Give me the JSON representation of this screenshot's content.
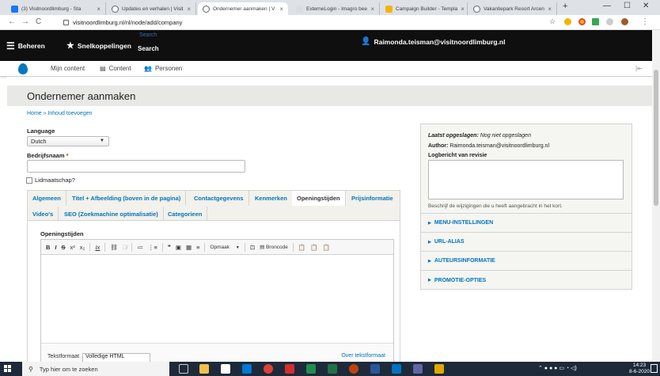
{
  "browser": {
    "tabs": [
      {
        "label": "(3) Visitnoordlimburg - Sta",
        "color": "#1877f2"
      },
      {
        "label": "Updates en verhalen | Visit",
        "color": "#5f6368"
      },
      {
        "label": "Ondernemer aanmaken | V",
        "color": "#5f6368"
      },
      {
        "label": "ExterneLogin - Imagro bee",
        "color": "#dadce0"
      },
      {
        "label": "Campaign Builder - Templa",
        "color": "#f4b400"
      },
      {
        "label": "Vakantiepark Resort Arcen",
        "color": "#5f6368"
      }
    ],
    "tab_close": "×",
    "new_tab": "+",
    "url": "visitnoordlimburg.nl/nl/node/add/company",
    "window_controls": {
      "minimize": "—",
      "maximize": "☐",
      "close": "✕"
    },
    "nav": {
      "back": "←",
      "forward": "→",
      "reload": "C"
    }
  },
  "toolbar": {
    "manage": "Beheren",
    "shortcuts": "Snelkoppelingen",
    "search_placeholder": "Search",
    "search_label": "Search",
    "user": "Raimonda.teisman@visitnoordlimburg.nl"
  },
  "tray": {
    "items": [
      "Mijn content",
      "Content",
      "Personen"
    ]
  },
  "page": {
    "title": "Ondernemer aanmaken",
    "breadcrumb": "Home » Inhoud toevoegen",
    "language_label": "Language",
    "language_value": "Dutch",
    "company_label": "Bedrijfsnaam",
    "required_mark": "*",
    "membership_label": "Lidmaatschap?",
    "tabs_row1": [
      "Algemeen",
      "Titel + Afbeelding (boven in de pagina)",
      "Contactgegevens",
      "Kenmerken",
      "Openingstijden",
      "Prijsinformatie"
    ],
    "tabs_row2": [
      "Video's",
      "SEO (Zoekmachine optimalisatie)",
      "Categorieen"
    ],
    "active_tab": "Openingstijden",
    "field_label": "Openingstijden",
    "editor": {
      "buttons": [
        "B",
        "I",
        "S",
        "x²",
        "x₂",
        "Ix",
        "⛓",
        "⛓̸",
        "≔",
        "⋮≡",
        "❞",
        "▣",
        "▦",
        "≡"
      ],
      "format": "Opmaak",
      "source": "Broncode",
      "text_format_label": "Tekstformaat",
      "text_format_value": "Volledige HTML",
      "about_link": "Over tekstformaat"
    }
  },
  "sidebar": {
    "last_saved_label": "Laatst opgeslagen:",
    "last_saved_value": "Nog niet opgeslagen",
    "author_label": "Author:",
    "author_value": "Raimonda.teisman@visitnoordlimburg.nl",
    "log_label": "Logbericht van revisie",
    "log_help": "Beschrijf de wijzigingen die u heeft aangebracht in het kort.",
    "sections": [
      "MENU-INSTELLINGEN",
      "URL-ALIAS",
      "AUTEURSINFORMATIE",
      "PROMOTIE-OPTIES"
    ]
  },
  "taskbar": {
    "search_placeholder": "Typ hier om te zoeken",
    "time": "14:23",
    "date": "8-6-2020"
  }
}
